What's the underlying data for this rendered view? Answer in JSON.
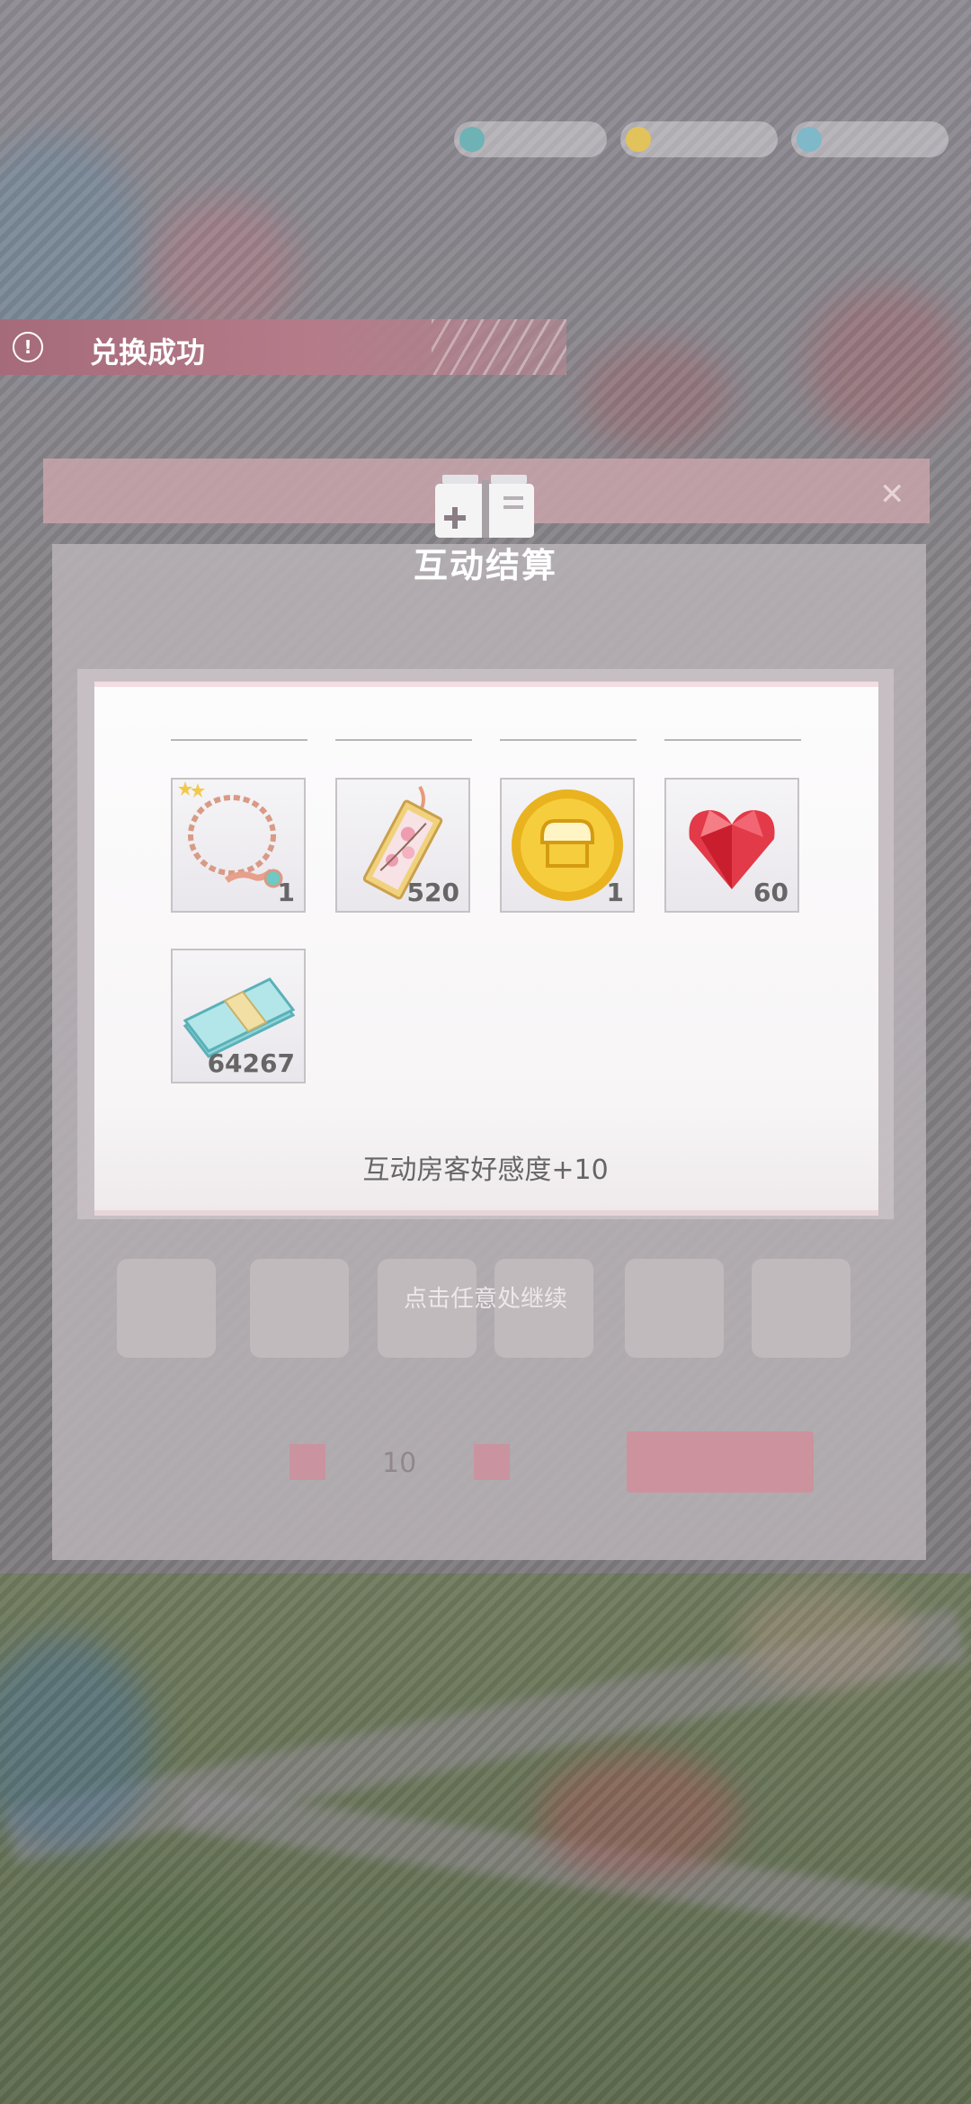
{
  "toast": {
    "icon": "alert-circle-icon",
    "message": "兑换成功"
  },
  "dialog": {
    "title": "互动结算",
    "header_icon": "box-icon",
    "rewards": [
      {
        "name": "necklace",
        "icon": "necklace-icon",
        "count": "1",
        "has_stars": true
      },
      {
        "name": "bookmark",
        "icon": "sakura-bookmark-icon",
        "count": "520"
      },
      {
        "name": "coin",
        "icon": "gold-shop-coin-icon",
        "count": "1"
      },
      {
        "name": "ruby-heart",
        "icon": "ruby-heart-icon",
        "count": "60"
      },
      {
        "name": "cash",
        "icon": "cash-stack-icon",
        "count": "64267"
      }
    ],
    "affinity_text": "互动房客好感度+10",
    "continue_hint": "点击任意处继续"
  },
  "background": {
    "faded_counter_value": "10"
  },
  "colors": {
    "toast_bg": "#a66b7b",
    "accent_pink": "#cf8f9b",
    "card_bg": "#fdfcfd"
  }
}
